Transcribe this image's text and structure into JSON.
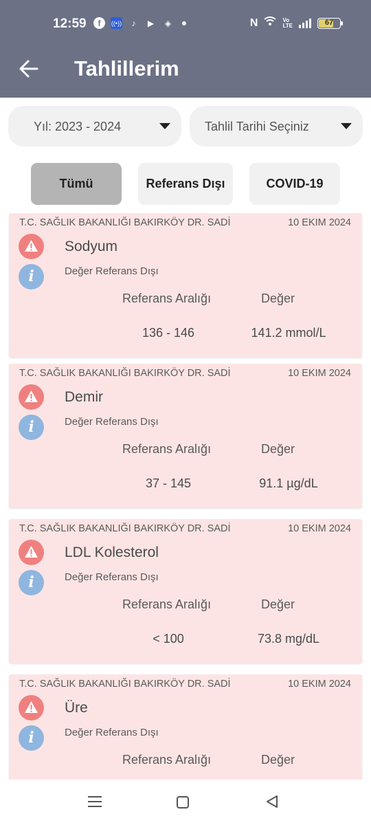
{
  "status_bar": {
    "time": "12:59",
    "battery": "67",
    "icons": [
      "facebook-icon",
      "broadcast-icon",
      "tiktok-icon",
      "youtube-icon",
      "box-icon",
      "dot-icon",
      "nfc-icon",
      "wifi-icon",
      "volte-icon",
      "signal-icon",
      "battery-icon"
    ]
  },
  "header": {
    "title": "Tahlillerim",
    "back_icon": "arrow-left-icon"
  },
  "filters": {
    "year_label": "Yıl: 2023 - 2024",
    "date_placeholder": "Tahlil Tarihi Seçiniz"
  },
  "tabs": [
    {
      "label": "Tümü",
      "active": true
    },
    {
      "label": "Referans Dışı",
      "active": false
    },
    {
      "label": "COVID-19",
      "active": false
    }
  ],
  "columns": {
    "range": "Referans Aralığı",
    "value": "Değer"
  },
  "results": [
    {
      "institution": "T.C. SAĞLIK BAKANLIĞI BAKIRKÖY DR. SADİ",
      "date": "10 EKIM 2024",
      "name": "Sodyum",
      "status": "Değer Referans Dışı",
      "range": "136 - 146",
      "value": "141.2 mmol/L"
    },
    {
      "institution": "T.C. SAĞLIK BAKANLIĞI BAKIRKÖY DR. SADİ",
      "date": "10 EKIM 2024",
      "name": "Demir",
      "status": "Değer Referans Dışı",
      "range": "37 - 145",
      "value": "91.1 µg/dL"
    },
    {
      "institution": "T.C. SAĞLIK BAKANLIĞI BAKIRKÖY DR. SADİ",
      "date": "10 EKIM 2024",
      "name": "LDL Kolesterol",
      "status": "Değer Referans Dışı",
      "range": "< 100",
      "value": "73.8 mg/dL"
    },
    {
      "institution": "T.C. SAĞLIK BAKANLIĞI BAKIRKÖY DR. SADİ",
      "date": "10 EKIM 2024",
      "name": "Üre",
      "status": "Değer Referans Dışı",
      "range": "",
      "value": ""
    }
  ],
  "colors": {
    "app_bar": "#6c7186",
    "card_background": "#fde4e4",
    "warning": "#f08080",
    "info": "#8fb6df",
    "active_tab": "#b4b4b4"
  }
}
